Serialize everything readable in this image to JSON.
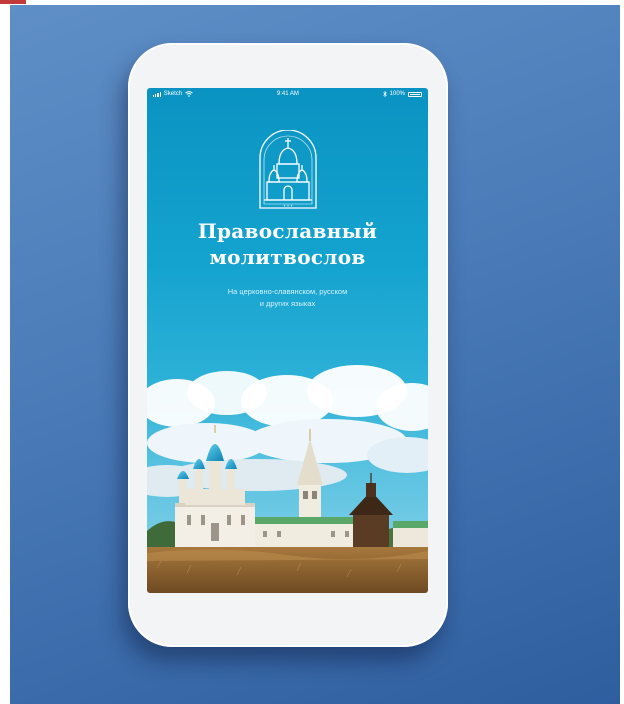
{
  "status_bar": {
    "carrier": "Sketch",
    "time": "9:41 AM",
    "battery": "100%"
  },
  "app": {
    "title_line1": "Православный",
    "title_line2": "молитвослов",
    "subtitle_line1": "На церковно-славянском, русском",
    "subtitle_line2": "и других языках"
  },
  "icons": {
    "signal": "signal-icon",
    "wifi": "wifi-icon",
    "bluetooth": "bluetooth-icon",
    "battery": "battery-icon",
    "emblem": "church-emblem-icon"
  },
  "colors": {
    "background": "#4a7bb8",
    "sky": "#14a3cf",
    "phone_body": "#f3f4f6"
  }
}
